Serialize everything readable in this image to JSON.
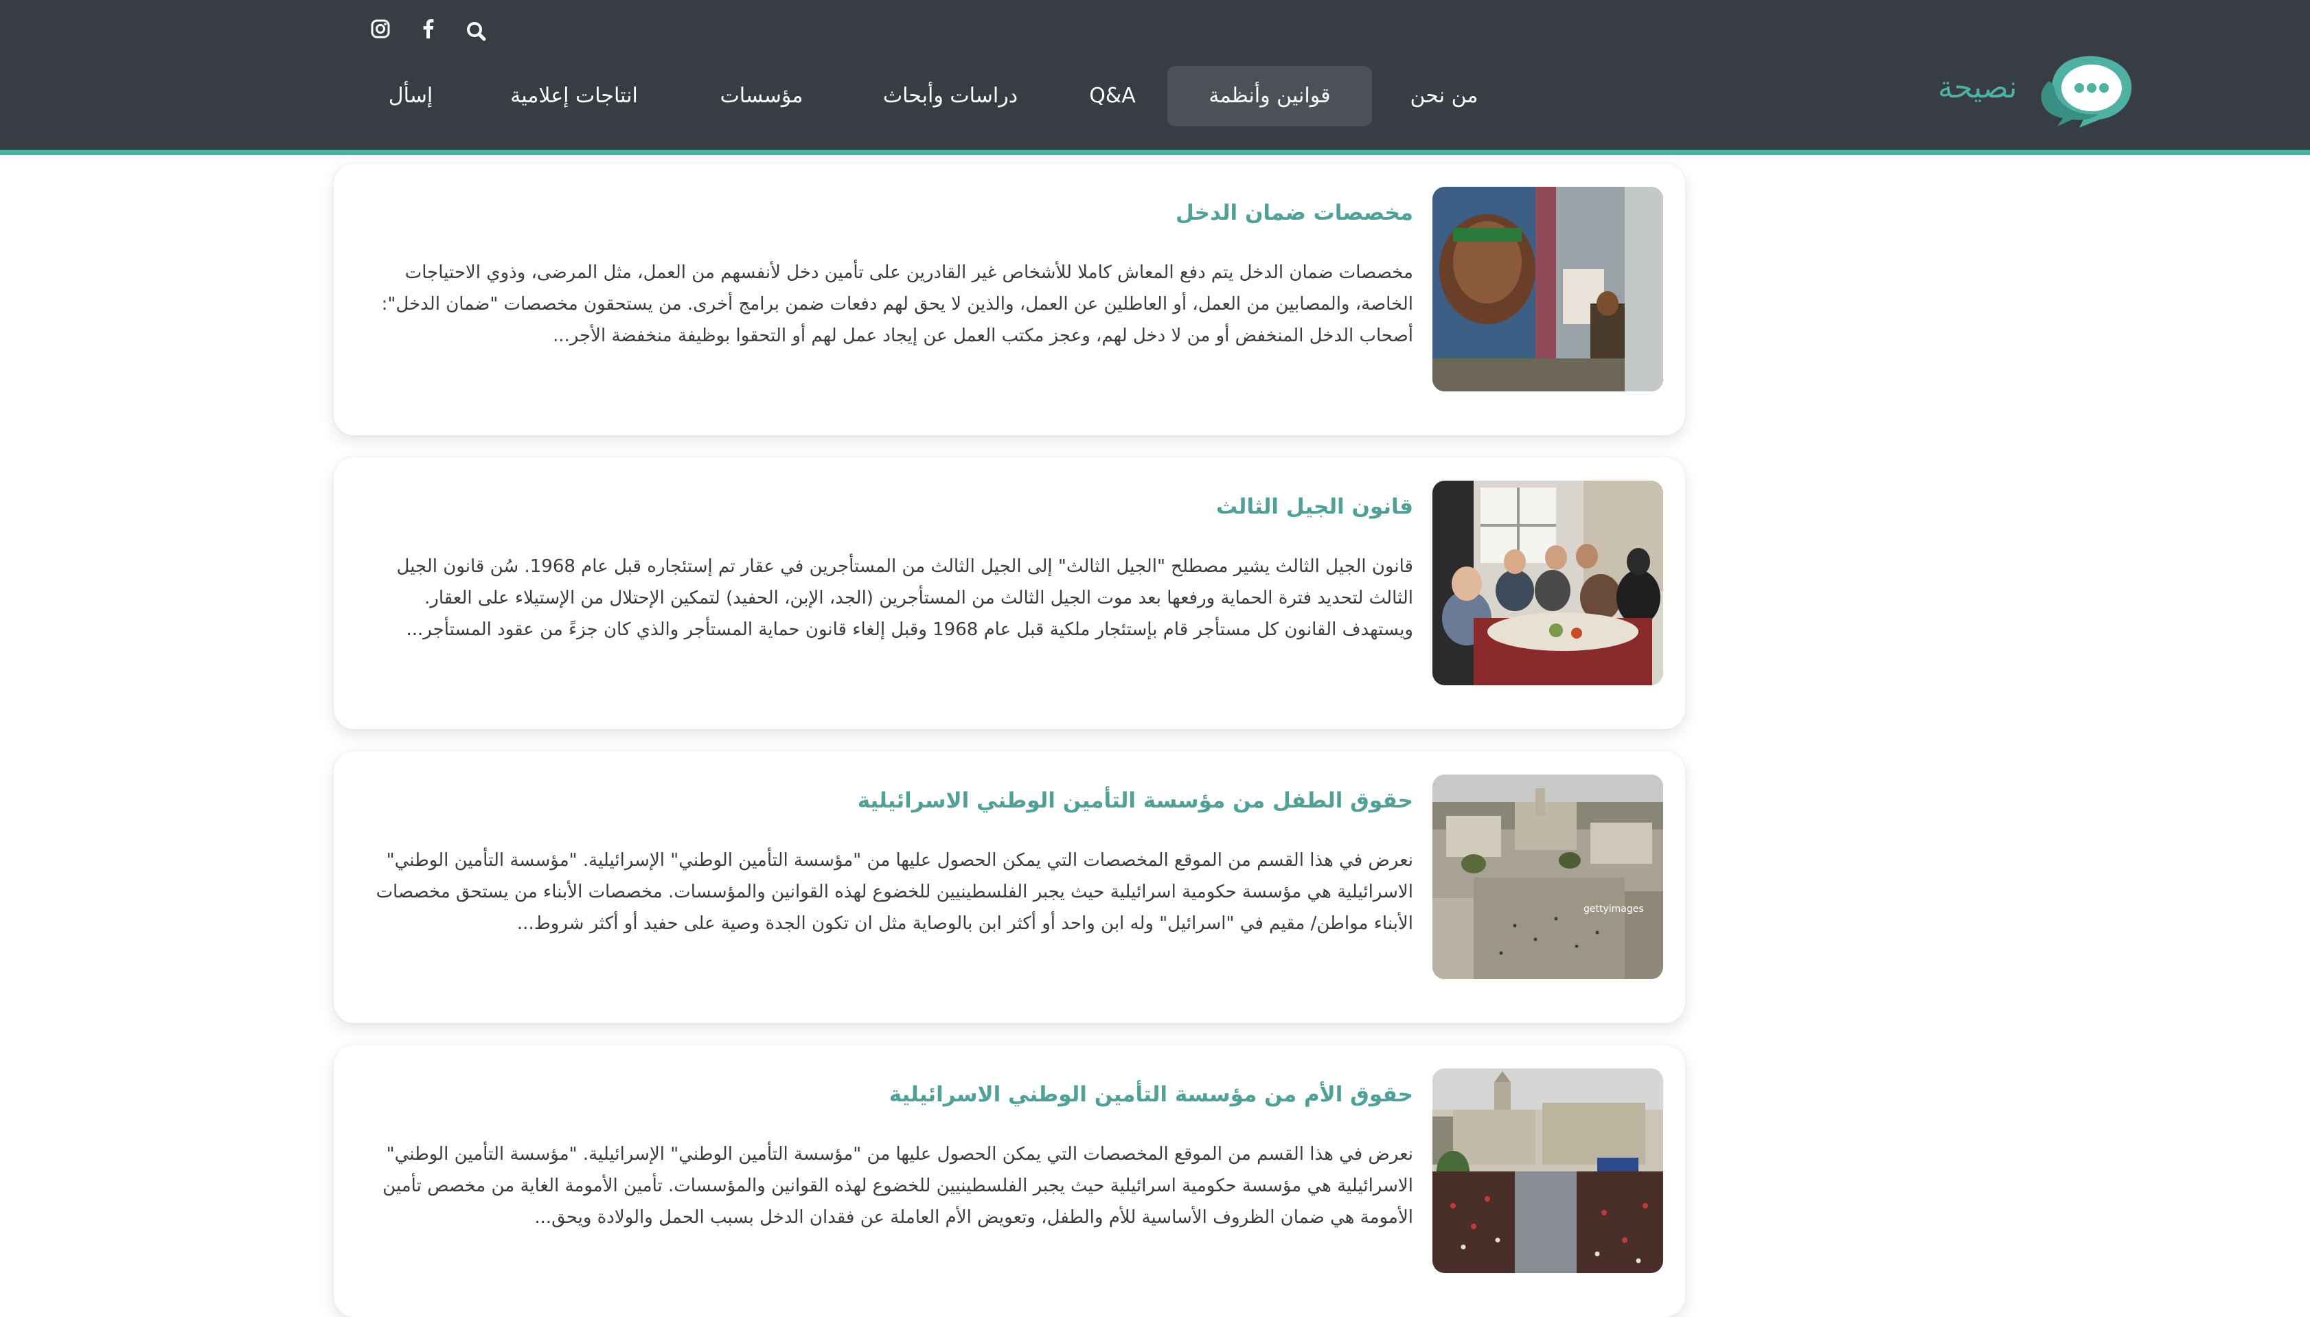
{
  "brand": {
    "name": "نصيحة",
    "brand_color": "#4fb0a4",
    "header_bg": "#373d43"
  },
  "nav": {
    "items": [
      {
        "label": "من نحن",
        "active": false
      },
      {
        "label": "قوانين وأنظمة",
        "active": true
      },
      {
        "label": "Q&A",
        "active": false
      },
      {
        "label": "دراسات وأبحاث",
        "active": false
      },
      {
        "label": "مؤسسات",
        "active": false
      },
      {
        "label": "انتاجات إعلامية",
        "active": false
      },
      {
        "label": "إسأل",
        "active": false
      }
    ]
  },
  "top_icons": [
    "search-icon",
    "facebook-icon",
    "instagram-icon"
  ],
  "articles": [
    {
      "title": "مخصصات ضمان الدخل",
      "text": "مخصصات ضمان الدخل يتم دفع المعاش كاملا للأشخاص غير القادرين على تأمين دخل لأنفسهم من العمل، مثل المرضى، وذوي الاحتياجات الخاصة، والمصابين من العمل، أو العاطلين عن العمل، والذين لا يحق لهم دفعات ضمن برامج أخرى. من يستحقون مخصصات \"ضمان الدخل\": أصحاب الدخل المنخفض أو من لا دخل لهم، وعجز مكتب العمل عن إيجاد عمل لهم أو التحقوا بوظيفة منخفضة الأجر...",
      "image": "mural-wall-photo"
    },
    {
      "title": "قانون الجيل الثالث",
      "text": "قانون الجيل الثالث يشير مصطلح \"الجيل الثالث\" إلى الجيل الثالث من المستأجرين في عقار تم إستئجاره قبل عام 1968. سُن قانون الجيل الثالث لتحديد فترة الحماية ورفعها بعد موت الجيل الثالث من المستأجرين (الجد، الإبن، الحفيد) لتمكين الإحتلال من الإستيلاء على العقار. ويستهدف القانون كل مستأجر قام بإستئجار ملكية قبل عام 1968 وقبل إلغاء قانون حماية المستأجر والذي كان جزءً من عقود المستأجر...",
      "image": "family-dinner-photo"
    },
    {
      "title": "حقوق الطفل من مؤسسة التأمين الوطني الاسرائيلية",
      "text": "نعرض في هذا القسم من الموقع المخصصات التي يمكن الحصول عليها من \"مؤسسة التأمين الوطني\" الإسرائيلية. \"مؤسسة التأمين الوطني\" الاسرائيلية هي مؤسسة حكومية اسرائيلية حيث يجبر الفلسطينيين للخضوع لهذه القوانين والمؤسسات. مخصصات الأبناء من يستحق مخصصات الأبناء مواطن/ مقيم في \"اسرائيل\" وله ابن واحد أو أكثر ابن بالوصاية مثل ان تكون الجدة وصية على حفيد أو أكثر شروط...",
      "image": "old-city-aerial-photo",
      "watermark": "gettyimages"
    },
    {
      "title": "حقوق الأم من مؤسسة التأمين الوطني الاسرائيلية",
      "text": "نعرض في هذا القسم من الموقع المخصصات التي يمكن الحصول عليها من \"مؤسسة التأمين الوطني\" الإسرائيلية. \"مؤسسة التأمين الوطني\" الاسرائيلية هي مؤسسة حكومية اسرائيلية حيث يجبر الفلسطينيين للخضوع لهذه القوانين والمؤسسات. تأمين الأمومة الغاية من مخصص تأمين الأمومة هي ضمان الظروف الأساسية للأم والطفل، وتعويض الأم العاملة عن فقدان الدخل بسبب الحمل والولادة ويحق...",
      "image": "crowd-square-photo"
    }
  ]
}
